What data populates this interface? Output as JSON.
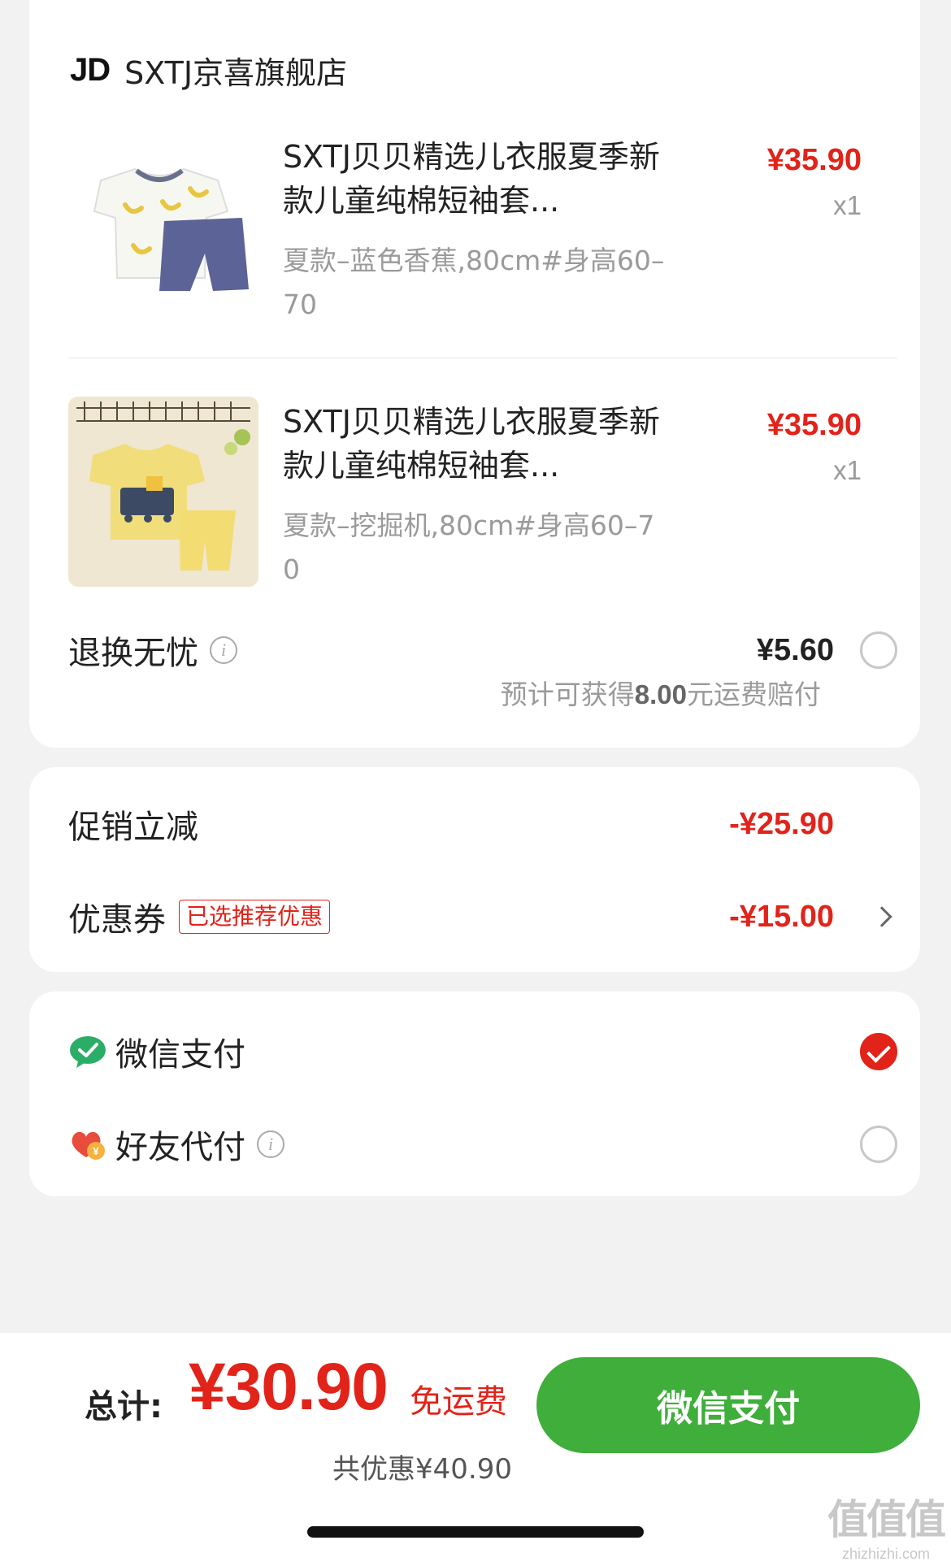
{
  "store": {
    "logo": "JD",
    "name": "SXTJ京喜旗舰店"
  },
  "items": [
    {
      "title": "SXTJ贝贝精选儿衣服夏季新款儿童纯棉短袖套...",
      "spec": "夏款–蓝色香蕉,80cm#身高60–70",
      "price": "¥35.90",
      "qty": "x1"
    },
    {
      "title": "SXTJ贝贝精选儿衣服夏季新款儿童纯棉短袖套...",
      "spec": "夏款–挖掘机,80cm#身高60–70",
      "price": "¥35.90",
      "qty": "x1"
    }
  ],
  "return_service": {
    "label": "退换无忧",
    "price": "¥5.60",
    "note_prefix": "预计可获得",
    "note_amount": "8.00",
    "note_suffix": "元运费赔付"
  },
  "promotions": {
    "discount_label": "促销立减",
    "discount_value": "-¥25.90",
    "coupon_label": "优惠券",
    "coupon_tag": "已选推荐优惠",
    "coupon_value": "-¥15.00"
  },
  "payment": {
    "wechat_label": "微信支付",
    "friend_label": "好友代付",
    "wechat_selected": true,
    "friend_selected": false
  },
  "summary": {
    "total_label": "总计:",
    "total_amount": "¥30.90",
    "shipping": "免运费",
    "saved": "共优惠¥40.90",
    "pay_button": "微信支付"
  },
  "watermark": {
    "glyphs": "值值值",
    "url": "zhizhizhi.com"
  },
  "colors": {
    "accent_red": "#e2231a",
    "pay_green": "#3fae3a",
    "wechat_green": "#2aae67"
  }
}
